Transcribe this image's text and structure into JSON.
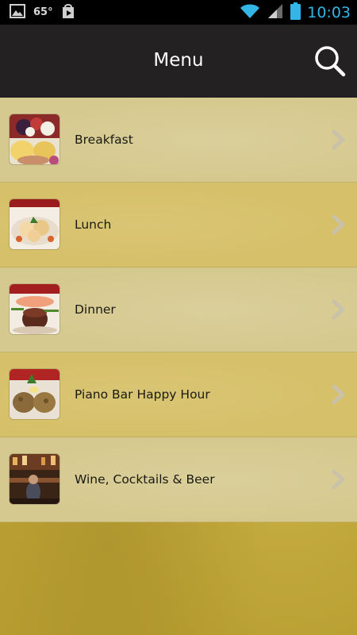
{
  "status_bar": {
    "temperature": "65°",
    "time": "10:03",
    "icons": [
      "gallery-icon",
      "play-store-icon",
      "wifi-icon",
      "signal-icon",
      "battery-icon"
    ]
  },
  "action_bar": {
    "title": "Menu",
    "search_icon": "search-icon"
  },
  "menu": {
    "items": [
      {
        "label": "Breakfast",
        "thumbnail": "breakfast-thumbnail"
      },
      {
        "label": "Lunch",
        "thumbnail": "lunch-thumbnail"
      },
      {
        "label": "Dinner",
        "thumbnail": "dinner-thumbnail"
      },
      {
        "label": "Piano Bar Happy Hour",
        "thumbnail": "happy-hour-thumbnail"
      },
      {
        "label": "Wine, Cocktails & Beer",
        "thumbnail": "wine-cocktails-thumbnail"
      }
    ]
  },
  "colors": {
    "status_bar": "#000000",
    "action_bar": "#232121",
    "time_accent": "#33b5e5",
    "row_light": "#d6c98f",
    "row_dark": "#d6c069",
    "background": "#c2a739"
  }
}
